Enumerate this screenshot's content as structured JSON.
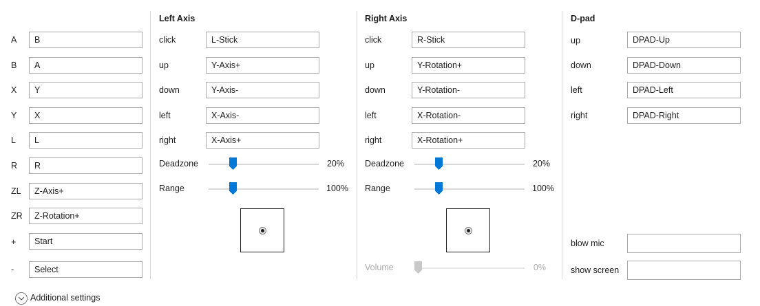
{
  "buttons": {
    "rows": [
      {
        "label": "A",
        "value": "B"
      },
      {
        "label": "B",
        "value": "A"
      },
      {
        "label": "X",
        "value": "Y"
      },
      {
        "label": "Y",
        "value": "X"
      },
      {
        "label": "L",
        "value": "L"
      },
      {
        "label": "R",
        "value": "R"
      },
      {
        "label": "ZL",
        "value": "Z-Axis+"
      },
      {
        "label": "ZR",
        "value": "Z-Rotation+"
      },
      {
        "label": "+",
        "value": "Start"
      },
      {
        "label": "-",
        "value": "Select"
      }
    ]
  },
  "left_axis": {
    "title": "Left Axis",
    "rows": [
      {
        "label": "click",
        "value": "L-Stick"
      },
      {
        "label": "up",
        "value": "Y-Axis+"
      },
      {
        "label": "down",
        "value": "Y-Axis-"
      },
      {
        "label": "left",
        "value": "X-Axis-"
      },
      {
        "label": "right",
        "value": "X-Axis+"
      }
    ],
    "deadzone": {
      "label": "Deadzone",
      "value": 20,
      "text": "20%"
    },
    "range": {
      "label": "Range",
      "value": 100,
      "text": "100%"
    }
  },
  "right_axis": {
    "title": "Right Axis",
    "rows": [
      {
        "label": "click",
        "value": "R-Stick"
      },
      {
        "label": "up",
        "value": "Y-Rotation+"
      },
      {
        "label": "down",
        "value": "Y-Rotation-"
      },
      {
        "label": "left",
        "value": "X-Rotation-"
      },
      {
        "label": "right",
        "value": "X-Rotation+"
      }
    ],
    "deadzone": {
      "label": "Deadzone",
      "value": 20,
      "text": "20%"
    },
    "range": {
      "label": "Range",
      "value": 100,
      "text": "100%"
    },
    "volume": {
      "label": "Volume",
      "value": 0,
      "text": "0%",
      "enabled": false
    }
  },
  "dpad": {
    "title": "D-pad",
    "rows": [
      {
        "label": "up",
        "value": "DPAD-Up"
      },
      {
        "label": "down",
        "value": "DPAD-Down"
      },
      {
        "label": "left",
        "value": "DPAD-Left"
      },
      {
        "label": "right",
        "value": "DPAD-Right"
      }
    ],
    "blow_mic": {
      "label": "blow mic",
      "value": ""
    },
    "show_screen": {
      "label": "show screen",
      "value": ""
    }
  },
  "additional_settings": {
    "label": "Additional settings",
    "icon": "chevron-down-icon"
  },
  "colors": {
    "accent": "#0078d7",
    "disabled": "#c8c8c8"
  }
}
